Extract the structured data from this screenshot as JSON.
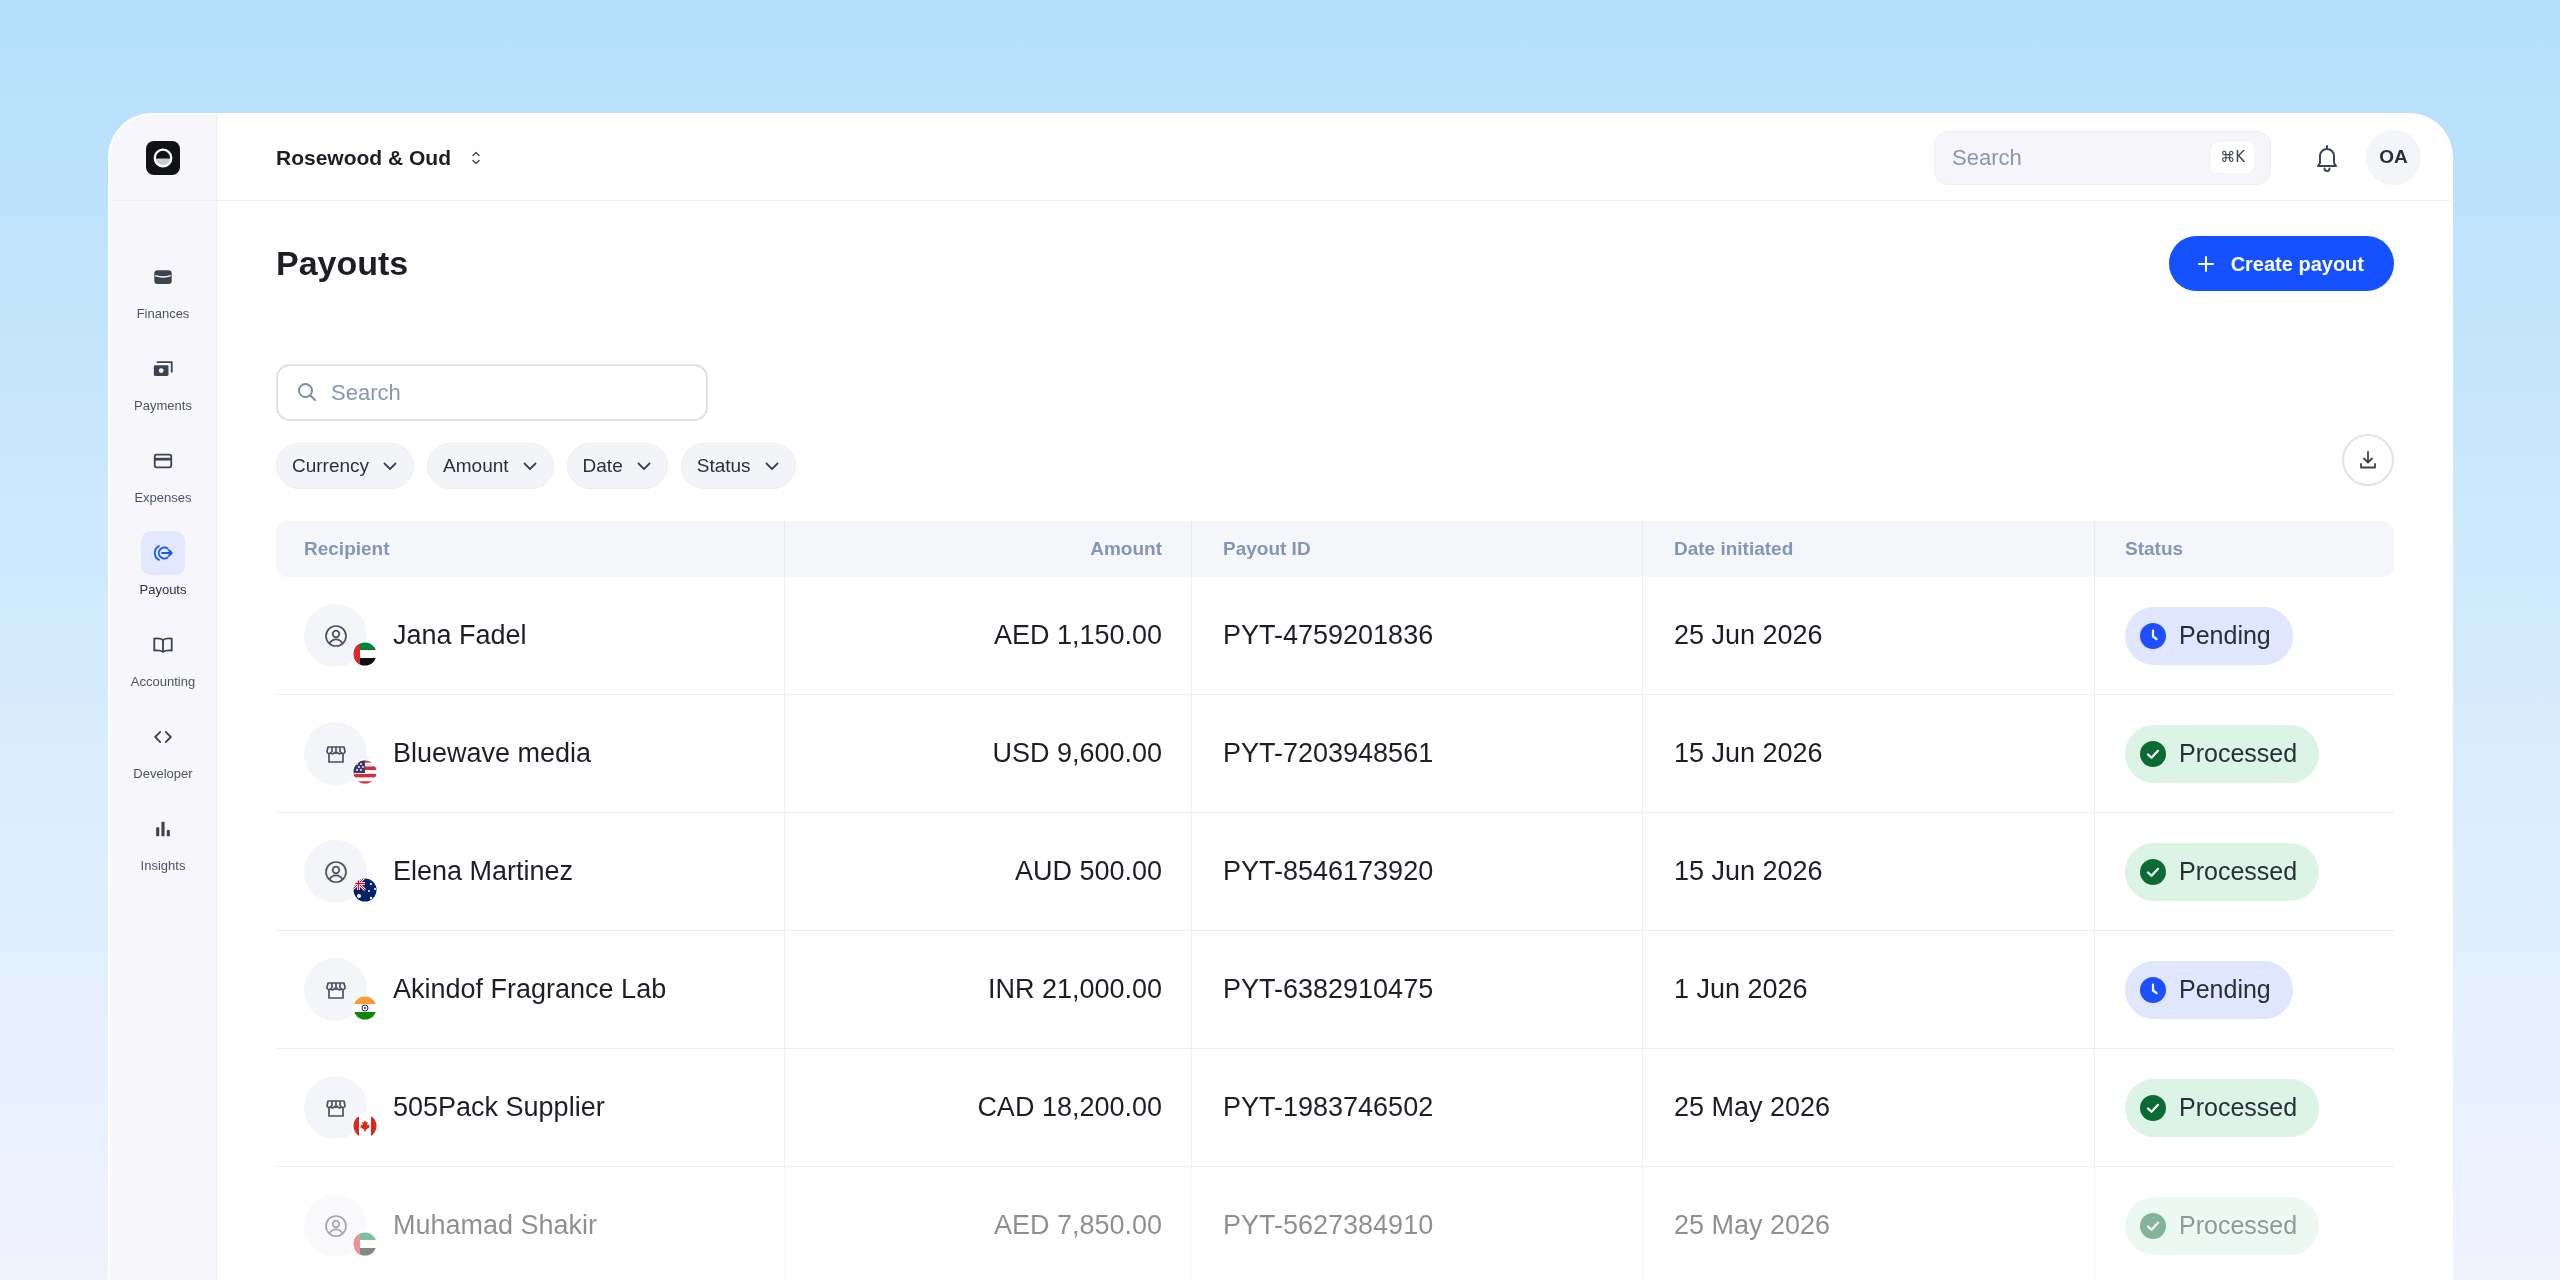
{
  "sidebar": {
    "items": [
      {
        "label": "Finances",
        "selected": false
      },
      {
        "label": "Payments",
        "selected": false
      },
      {
        "label": "Expenses",
        "selected": false
      },
      {
        "label": "Payouts",
        "selected": true
      },
      {
        "label": "Accounting",
        "selected": false
      },
      {
        "label": "Developer",
        "selected": false
      },
      {
        "label": "Insights",
        "selected": false
      }
    ]
  },
  "top_bar": {
    "workspace": "Rosewood & Oud",
    "search": {
      "placeholder": "Search",
      "shortcut": "⌘K"
    },
    "avatar": "OA"
  },
  "page": {
    "title": "Payouts",
    "create_button": "Create payout"
  },
  "search": {
    "placeholder": "Search"
  },
  "filters": [
    "Currency",
    "Amount",
    "Date",
    "Status"
  ],
  "table": {
    "columns": [
      "Recipient",
      "Amount",
      "Payout ID",
      "Date initiated",
      "Status"
    ],
    "rows": [
      {
        "recipient": {
          "name": "Jana Fadel",
          "kind": "person",
          "flag": {
            "kind": "ae"
          }
        },
        "amount": "AED 1,150.00",
        "payout_id": "PYT-4759201836",
        "date": "25 Jun 2026",
        "status": {
          "label": "Pending",
          "kind": "pending"
        }
      },
      {
        "recipient": {
          "name": "Bluewave media",
          "kind": "business",
          "flag": {
            "kind": "us"
          }
        },
        "amount": "USD 9,600.00",
        "payout_id": "PYT-7203948561",
        "date": "15 Jun 2026",
        "status": {
          "label": "Processed",
          "kind": "processed"
        }
      },
      {
        "recipient": {
          "name": "Elena Martinez",
          "kind": "person",
          "flag": {
            "kind": "au"
          }
        },
        "amount": "AUD 500.00",
        "payout_id": "PYT-8546173920",
        "date": "15 Jun 2026",
        "status": {
          "label": "Processed",
          "kind": "processed"
        }
      },
      {
        "recipient": {
          "name": "Akindof Fragrance Lab",
          "kind": "business",
          "flag": {
            "kind": "in"
          }
        },
        "amount": "INR 21,000.00",
        "payout_id": "PYT-6382910475",
        "date": "1 Jun 2026",
        "status": {
          "label": "Pending",
          "kind": "pending"
        }
      },
      {
        "recipient": {
          "name": "505Pack Supplier",
          "kind": "business",
          "flag": {
            "kind": "ca"
          }
        },
        "amount": "CAD 18,200.00",
        "payout_id": "PYT-1983746502",
        "date": "25 May 2026",
        "status": {
          "label": "Processed",
          "kind": "processed"
        }
      },
      {
        "recipient": {
          "name": "Muhamad Shakir",
          "kind": "person",
          "flag": {
            "kind": "ae"
          }
        },
        "amount": "AED 7,850.00",
        "payout_id": "PYT-5627384910",
        "date": "25 May 2026",
        "status": {
          "label": "Processed",
          "kind": "processed"
        }
      }
    ]
  }
}
